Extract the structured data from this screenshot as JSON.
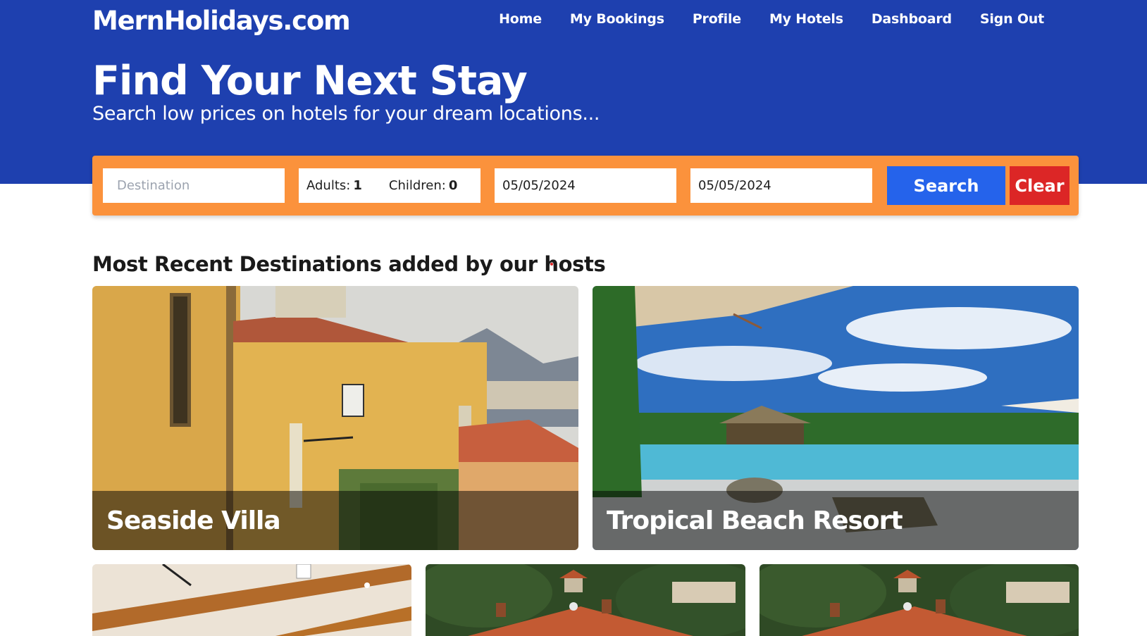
{
  "site": {
    "logo": "MernHolidays.com"
  },
  "nav": [
    {
      "label": "Home"
    },
    {
      "label": "My Bookings"
    },
    {
      "label": "Profile"
    },
    {
      "label": "My Hotels"
    },
    {
      "label": "Dashboard"
    },
    {
      "label": "Sign Out"
    }
  ],
  "hero": {
    "title": "Find Your Next Stay",
    "subtitle": "Search low prices on hotels for your dream locations..."
  },
  "search": {
    "destination_placeholder": "Destination",
    "destination_value": "",
    "adults_label": "Adults:",
    "adults_value": "1",
    "children_label": "Children:",
    "children_value": "0",
    "check_in": "05/05/2024",
    "check_out": "05/05/2024",
    "search_label": "Search",
    "clear_label": "Clear"
  },
  "section": {
    "title": "Most Recent Destinations added by our hosts"
  },
  "hotels": [
    {
      "name": "Seaside Villa"
    },
    {
      "name": "Tropical Beach Resort"
    },
    {
      "name": ""
    },
    {
      "name": ""
    },
    {
      "name": ""
    }
  ],
  "colors": {
    "hero_bg": "#1e40af",
    "search_bar_bg": "#fb923c",
    "search_button": "#2563eb",
    "clear_button": "#dc2626"
  }
}
